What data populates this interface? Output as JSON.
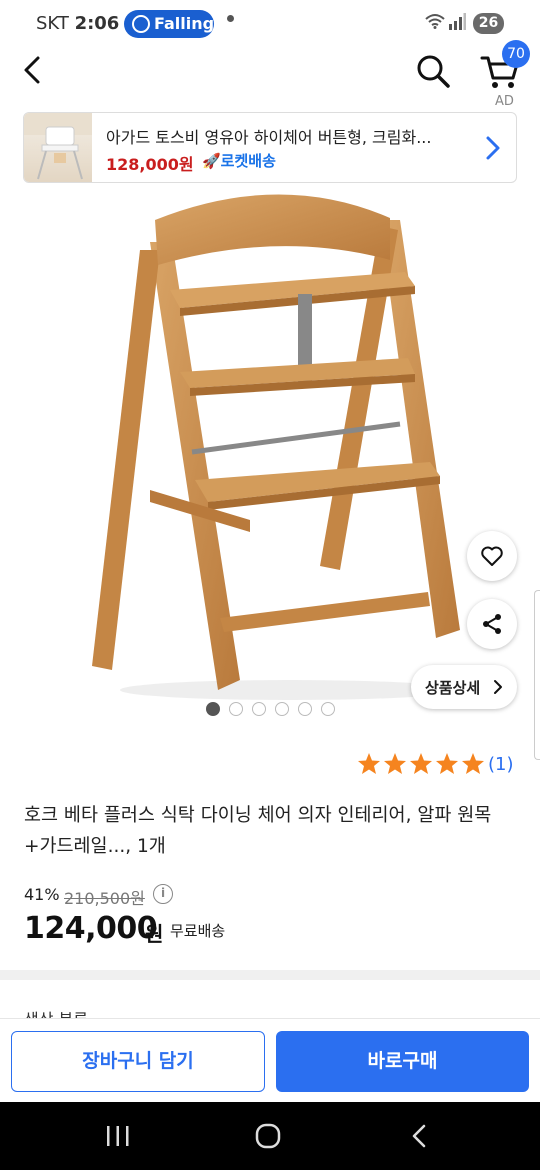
{
  "status_bar": {
    "carrier": "SKT",
    "time": "2:06",
    "pill_label": "Falling",
    "battery": "26"
  },
  "header": {
    "cart_count": "70",
    "ad_label": "AD"
  },
  "ad_banner": {
    "title": "아가드 토스비 영유아 하이체어 버튼형, 크림화...",
    "price": "128,000원",
    "badge": "🚀로켓배송"
  },
  "gallery": {
    "total_images": 6,
    "current_index": 1,
    "detail_button": "상품상세"
  },
  "product": {
    "rating_stars": 5,
    "review_count": "(1)",
    "title": "호크 베타 플러스 식탁 다이닝 체어 의자 인테리어, 알파 원목+가드레일..., 1개",
    "discount": "41%",
    "original_price": "210,500원",
    "price": "124,000",
    "price_unit": "원",
    "shipping": "무료배송"
  },
  "next_section_peek": "색상 분류",
  "actions": {
    "add_to_cart": "장바구니 담기",
    "buy_now": "바로구매"
  },
  "colors": {
    "accent": "#2b6ff0",
    "ad_price": "#c91e1e",
    "star": "#f5841f",
    "wood": "#c98f4f"
  }
}
